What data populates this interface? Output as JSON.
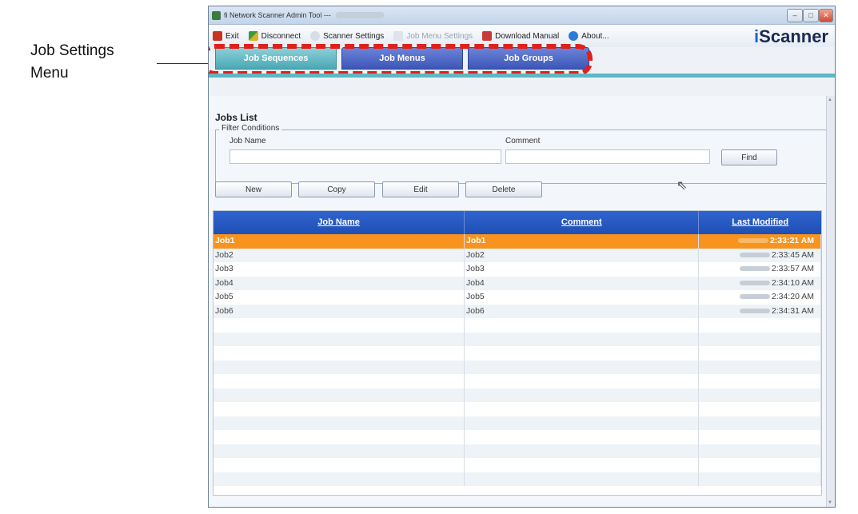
{
  "callout": {
    "line1": "Job Settings",
    "line2": "Menu"
  },
  "window": {
    "title": "fi Network Scanner Admin Tool ---"
  },
  "toolbar": {
    "exit": "Exit",
    "disconnect": "Disconnect",
    "scanner_settings": "Scanner Settings",
    "job_menu_settings": "Job Menu Settings",
    "download_manual": "Download Manual",
    "about": "About...",
    "logo_i": "i",
    "logo_rest": "Scanner"
  },
  "tabs": [
    {
      "label": "Job Sequences"
    },
    {
      "label": "Job Menus"
    },
    {
      "label": "Job Groups"
    }
  ],
  "jobs_list": {
    "title": "Jobs List",
    "filter": {
      "legend": "Filter Conditions",
      "job_name_label": "Job Name",
      "comment_label": "Comment",
      "find": "Find"
    },
    "actions": {
      "new": "New",
      "copy": "Copy",
      "edit": "Edit",
      "delete": "Delete"
    },
    "columns": [
      "Job Name",
      "Comment",
      "Last Modified"
    ],
    "rows": [
      {
        "name": "Job1",
        "comment": "Job1",
        "time": "2:33:21 AM"
      },
      {
        "name": "Job2",
        "comment": "Job2",
        "time": "2:33:45 AM"
      },
      {
        "name": "Job3",
        "comment": "Job3",
        "time": "2:33:57 AM"
      },
      {
        "name": "Job4",
        "comment": "Job4",
        "time": "2:34:10 AM"
      },
      {
        "name": "Job5",
        "comment": "Job5",
        "time": "2:34:20 AM"
      },
      {
        "name": "Job6",
        "comment": "Job6",
        "time": "2:34:31 AM"
      }
    ]
  },
  "colors": {
    "accent_blue": "#2f64cf",
    "selected_row": "#f7931e",
    "active_tab": "#4aa8b4",
    "highlight_dash": "#e0201a"
  }
}
